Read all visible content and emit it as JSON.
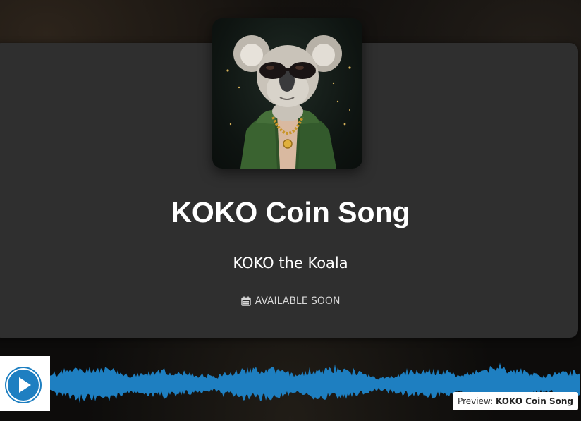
{
  "song": {
    "title": "KOKO Coin Song",
    "artist": "KOKO the Koala",
    "availability": "AVAILABLE SOON",
    "availability_icon": "calendar-icon"
  },
  "cover_art": {
    "subject": "koala wearing sunglasses, green jacket and gold chain"
  },
  "player": {
    "play_icon": "play-icon",
    "preview_label": "Preview:",
    "preview_title": "KOKO Coin Song"
  },
  "colors": {
    "accent": "#1e7fc1",
    "card": "#2f2f2f",
    "text": "#ffffff"
  }
}
